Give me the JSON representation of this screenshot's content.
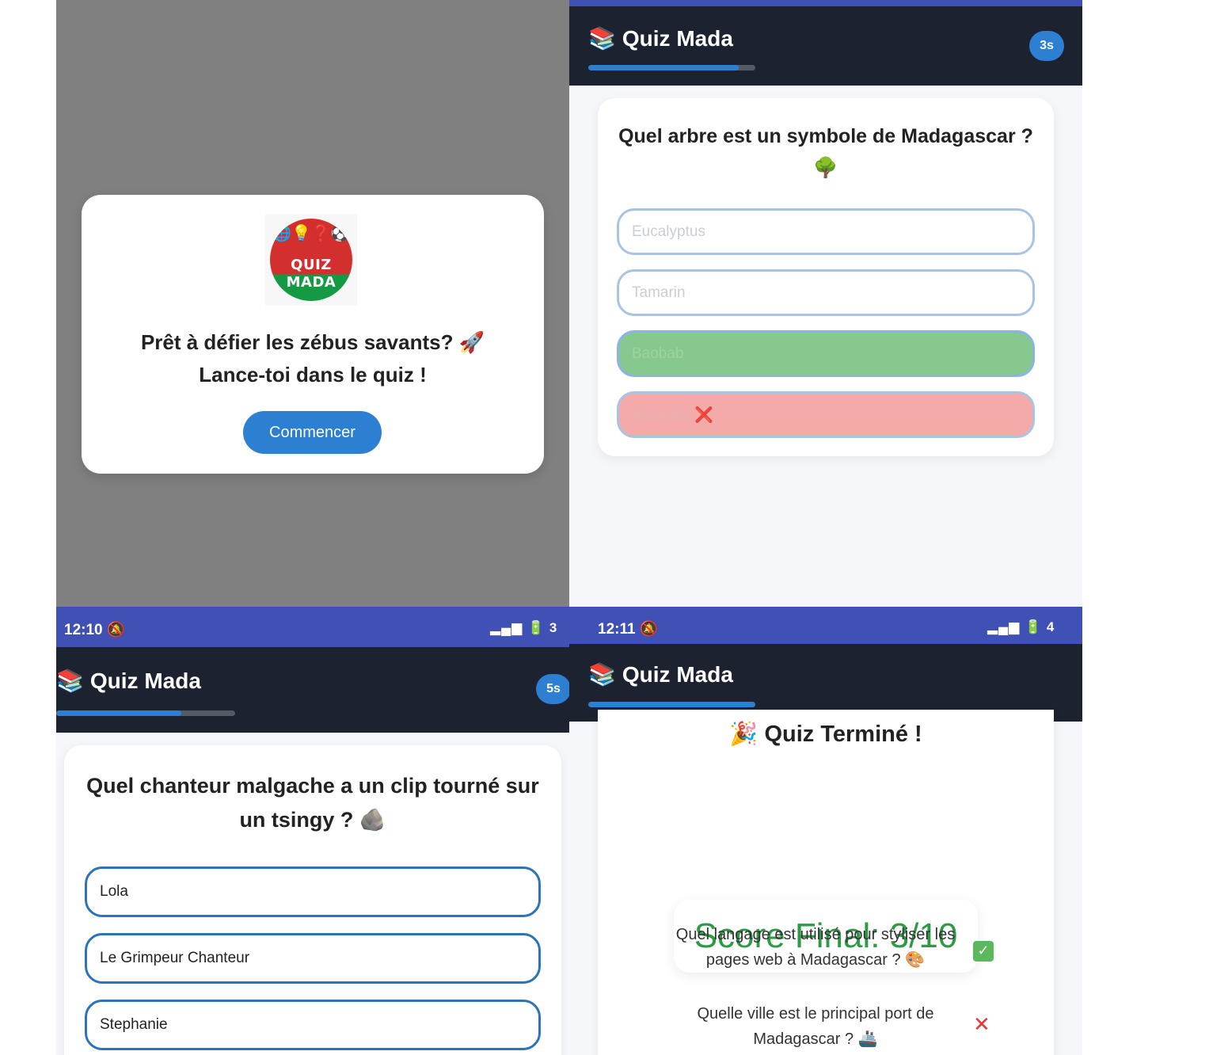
{
  "start": {
    "logo_line1": "QUIZ",
    "logo_line2": "MADA",
    "logo_glyphs": "🌐💡❓⚽",
    "message_line1": "Prêt à défier les zébus savants? 🚀",
    "message_line2": "Lance-toi dans le quiz !",
    "start_button": "Commencer"
  },
  "quiz_q1": {
    "app_title": "Quiz Mada",
    "app_icon": "📚",
    "timer": "3s",
    "progress": 0.9,
    "question": "Quel arbre est un symbole de Madagascar ?",
    "question_emoji": "🌳",
    "options": [
      {
        "label": "Eucalyptus",
        "state": "default"
      },
      {
        "label": "Tamarin",
        "state": "default"
      },
      {
        "label": "Baobab",
        "state": "correct"
      },
      {
        "label": "Ravinala ❌",
        "state": "wrong"
      }
    ]
  },
  "quiz_q2": {
    "status_time": "12:10",
    "status_right": "3",
    "app_title": "Quiz Mada",
    "app_icon": "📚",
    "timer": "5s",
    "progress": 0.7,
    "question_line1": "Quel chanteur malgache a un clip tourné sur",
    "question_line2": "un tsingy ? 🪨",
    "options": [
      {
        "label": "Lola"
      },
      {
        "label": "Le Grimpeur Chanteur"
      },
      {
        "label": "Stephanie"
      }
    ]
  },
  "result": {
    "status_time": "12:11",
    "status_right": "4",
    "app_title": "Quiz Mada",
    "app_icon": "📚",
    "progress": 1.0,
    "heading": "🎉 Quiz Terminé !",
    "score": "Score Final: 3/10",
    "answers": [
      {
        "line1": "Quel langage est utilisé pour styliser les",
        "line2": "pages web à Madagascar ? 🎨",
        "mark": "✓",
        "correct": true
      },
      {
        "line1": "Quelle ville est le principal port de",
        "line2": "Madagascar ? 🚢",
        "mark": "✕",
        "correct": false
      }
    ]
  }
}
